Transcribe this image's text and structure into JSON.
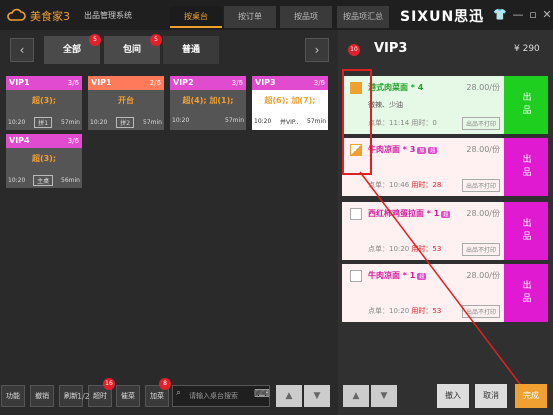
{
  "app": {
    "title": "美食家3",
    "subtitle": "出品管理系统",
    "brand": "SIXUN思迅"
  },
  "top_tabs": [
    "按桌台",
    "按订单",
    "按品项",
    "按品项汇总"
  ],
  "window": {
    "icons": [
      "shirt-icon",
      "minimize-icon",
      "restore-icon",
      "close-icon"
    ]
  },
  "filters": [
    {
      "label": "全部",
      "badge": "5"
    },
    {
      "label": "包间",
      "badge": "5"
    },
    {
      "label": "普通"
    }
  ],
  "tables": [
    {
      "name": "VIP1",
      "count": "3/6",
      "status": "超(3);",
      "time": "10:20",
      "tag": "拼1",
      "mins": "57min",
      "head": "#e04bd0"
    },
    {
      "name": "VIP1",
      "count": "2/6",
      "status": "开台",
      "time": "10:20",
      "tag": "拼2",
      "mins": "57min",
      "head": "#ff7a5a"
    },
    {
      "name": "VIP2",
      "count": "3/6",
      "status": "超(4); 加(1);",
      "time": "10:20",
      "tag": "",
      "mins": "57min",
      "head": "#e04bd0"
    },
    {
      "name": "VIP3",
      "count": "3/6",
      "status": "超(6); 加(7);",
      "time": "10:20",
      "tag": "并VIP..",
      "mins": "57min",
      "head": "#e04bd0"
    },
    {
      "name": "VIP4",
      "count": "3/6",
      "status": "超(3);",
      "time": "10:20",
      "tag": "主桌",
      "mins": "56min",
      "head": "#e04bd0"
    }
  ],
  "bottom_left": {
    "buttons": [
      "功能",
      "撤销",
      "刷新",
      "超时",
      "催菜",
      "加菜"
    ],
    "overdue_badge": "16",
    "add_badge": "8",
    "search_placeholder": "请输入桌台搜索"
  },
  "right": {
    "badge": "10",
    "title": "VIP3",
    "price": "¥ 290",
    "dishes": [
      {
        "name": "港式肉菜面 * 4",
        "badges": [],
        "price": "28.00/份",
        "note": "微辣、少油",
        "placed": "点单：11:14",
        "wait": "用时：0",
        "print": "出品不打印",
        "check": "on",
        "serve": "出品",
        "done": true
      },
      {
        "name": "牛肉凉面 * 3",
        "badges": [
          "加",
          "超"
        ],
        "price": "28.00/份",
        "note": "",
        "placed": "点单：10:46",
        "wait": "用时：28",
        "print": "出品不打印",
        "check": "half",
        "serve": "出品",
        "done": false
      },
      {
        "name": "西红柿鸡蛋拉面 * 1",
        "badges": [
          "超"
        ],
        "price": "28.00/份",
        "note": "",
        "placed": "点单：10:20",
        "wait": "用时：53",
        "print": "出品不打印",
        "check": "off",
        "serve": "出品",
        "done": false
      },
      {
        "name": "牛肉凉面 * 1",
        "badges": [
          "超"
        ],
        "price": "28.00/份",
        "note": "",
        "placed": "点单：10:20",
        "wait": "用时：53",
        "print": "出品不打印",
        "check": "off",
        "serve": "出品",
        "done": false
      }
    ],
    "page": "1/2",
    "buttons": [
      "撤入",
      "取消"
    ],
    "complete": "完成"
  }
}
